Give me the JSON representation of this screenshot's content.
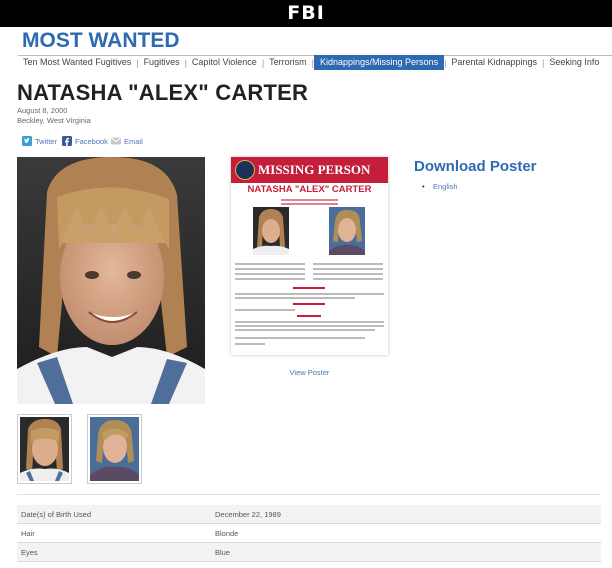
{
  "header": {
    "agency": "FBI",
    "section_title": "MOST WANTED"
  },
  "nav": {
    "items": [
      {
        "label": "Ten Most Wanted Fugitives"
      },
      {
        "label": "Fugitives"
      },
      {
        "label": "Capitol Violence"
      },
      {
        "label": "Terrorism"
      },
      {
        "label": "Kidnappings/Missing Persons",
        "active": true
      },
      {
        "label": "Parental Kidnappings"
      },
      {
        "label": "Seeking Info"
      }
    ]
  },
  "subject": {
    "name": "NATASHA \"ALEX\" CARTER",
    "date": "August 8, 2000",
    "place": "Beckley, West Virginia"
  },
  "share": {
    "twitter": "Twitter",
    "facebook": "Facebook",
    "email": "Email"
  },
  "poster": {
    "heading": "MISSING PERSON",
    "name": "NATASHA \"ALEX\" CARTER",
    "view_label": "View Poster"
  },
  "download": {
    "title": "Download Poster",
    "items": [
      {
        "label": "English"
      }
    ]
  },
  "details": {
    "rows": [
      {
        "label": "Date(s) of Birth Used",
        "value": "December 22, 1989"
      },
      {
        "label": "Hair",
        "value": "Blonde"
      },
      {
        "label": "Eyes",
        "value": "Blue"
      }
    ]
  },
  "colors": {
    "accent": "#2e6ab1",
    "poster_red": "#c41e3a",
    "topbar": "#000000"
  }
}
